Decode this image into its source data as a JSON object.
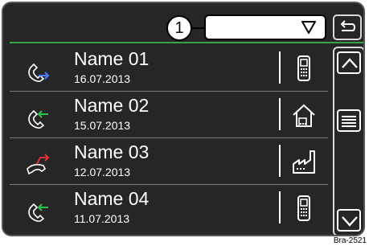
{
  "callout": {
    "number": "1"
  },
  "contacts": [
    {
      "name": "Name 01",
      "date": "16.07.2013",
      "call_type": "outgoing-call-icon",
      "number_type": "mobile-phone-icon",
      "arrow_color": "#4a7fff"
    },
    {
      "name": "Name 02",
      "date": "15.07.2013",
      "call_type": "incoming-call-icon",
      "number_type": "home-phone-icon",
      "arrow_color": "#2ec24a"
    },
    {
      "name": "Name 03",
      "date": "12.07.2013",
      "call_type": "missed-call-icon",
      "number_type": "work-phone-icon",
      "arrow_color": "#e0303a"
    },
    {
      "name": "Name 04",
      "date": "11.07.2013",
      "call_type": "incoming-call-icon",
      "number_type": "mobile-phone-icon",
      "arrow_color": "#2ec24a"
    }
  ],
  "accent_color": "#3aa34a",
  "image_tag": "Bra-2521"
}
